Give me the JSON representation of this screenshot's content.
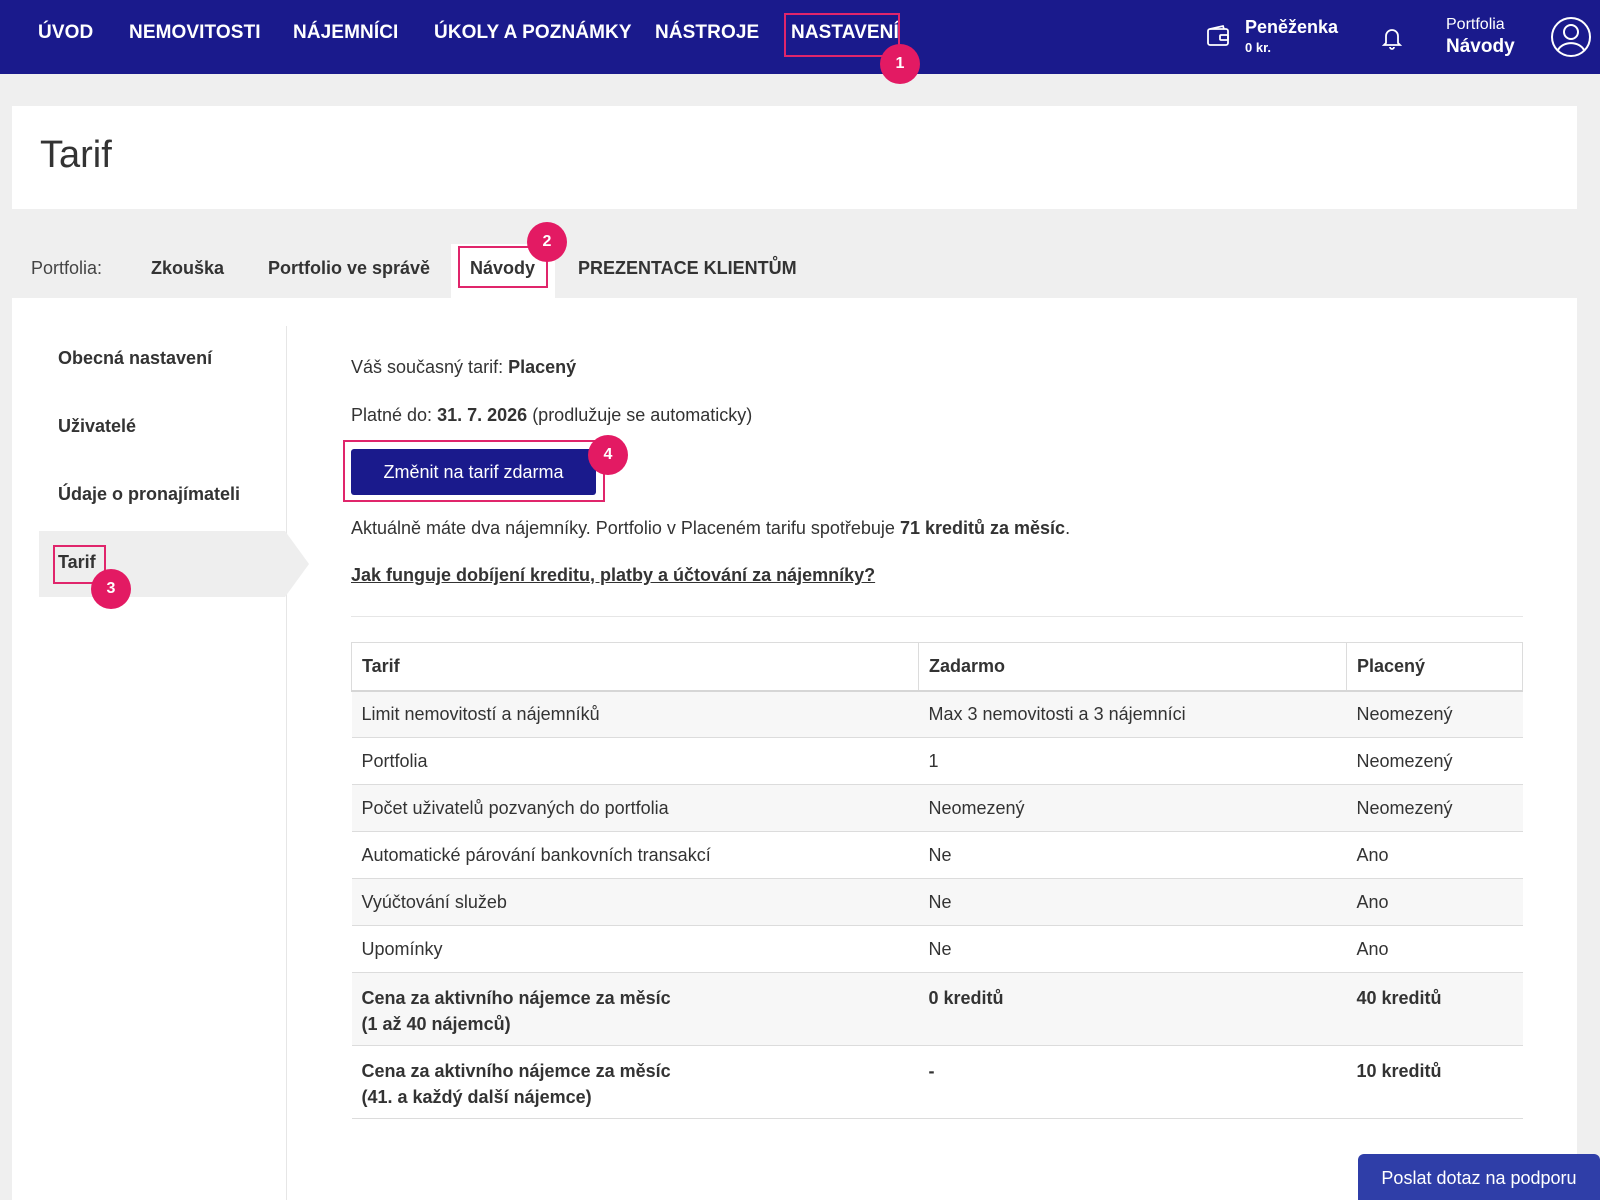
{
  "nav": {
    "items": [
      "ÚVOD",
      "NEMOVITOSTI",
      "NÁJEMNÍCI",
      "ÚKOLY A POZNÁMKY",
      "NÁSTROJE",
      "NASTAVENÍ"
    ],
    "active": "NASTAVENÍ"
  },
  "wallet": {
    "title": "Peněženka",
    "amount": "0 kr.",
    "icon": "wallet-icon"
  },
  "notifications": {
    "icon": "bell-icon"
  },
  "portfolio": {
    "caption": "Portfolia",
    "name": "Návody"
  },
  "user": {
    "icon": "user-avatar-icon"
  },
  "page": {
    "title": "Tarif"
  },
  "tabs": {
    "label": "Portfolia:",
    "items": [
      "Zkouška",
      "Portfolio ve správě",
      "Návody",
      "PREZENTACE KLIENTŮM"
    ],
    "active": "Návody"
  },
  "sidebar": {
    "items": [
      "Obecná nastavení",
      "Uživatelé",
      "Údaje o pronajímateli",
      "Tarif"
    ],
    "active": "Tarif"
  },
  "badges": [
    "1",
    "2",
    "3",
    "4"
  ],
  "content": {
    "current_label": "Váš současný tarif:",
    "current_value": "Placený",
    "valid_label": "Platné do:",
    "valid_date": "31. 7. 2026",
    "valid_note": "(prodlužuje se automaticky)",
    "change_button": "Změnit na tarif zdarma",
    "usage_text": "Aktuálně máte dva nájemníky. Portfolio v Placeném tarifu spotřebuje",
    "usage_bold": "71 kreditů za měsíc",
    "usage_end": ".",
    "help_link": "Jak funguje dobíjení kreditu, platby a účtování za nájemníky?"
  },
  "table": {
    "headers": [
      "Tarif",
      "Zadarmo",
      "Placený"
    ],
    "rows": [
      [
        "Limit nemovitostí a nájemníků",
        "Max 3 nemovitosti a 3 nájemníci",
        "Neomezený"
      ],
      [
        "Portfolia",
        "1",
        "Neomezený"
      ],
      [
        "Počet uživatelů pozvaných do portfolia",
        "Neomezený",
        "Neomezený"
      ],
      [
        "Automatické párování bankovních transakcí",
        "Ne",
        "Ano"
      ],
      [
        "Vyúčtování služeb",
        "Ne",
        "Ano"
      ],
      [
        "Upomínky",
        "Ne",
        "Ano"
      ]
    ],
    "price_rows": [
      {
        "line1": "Cena za aktivního nájemce za měsíc",
        "line2": "(1 až 40 nájemců)",
        "free": "0 kreditů",
        "paid": "40 kreditů"
      },
      {
        "line1": "Cena za aktivního nájemce za měsíc",
        "line2": "(41. a každý další nájemce)",
        "free": "-",
        "paid": "10 kreditů"
      }
    ]
  },
  "support_button": "Poslat dotaz na podporu",
  "colors": {
    "primary": "#1a1a8c",
    "highlight": "#e0256b",
    "badge": "#e31a63",
    "support": "#2f3ea8"
  }
}
